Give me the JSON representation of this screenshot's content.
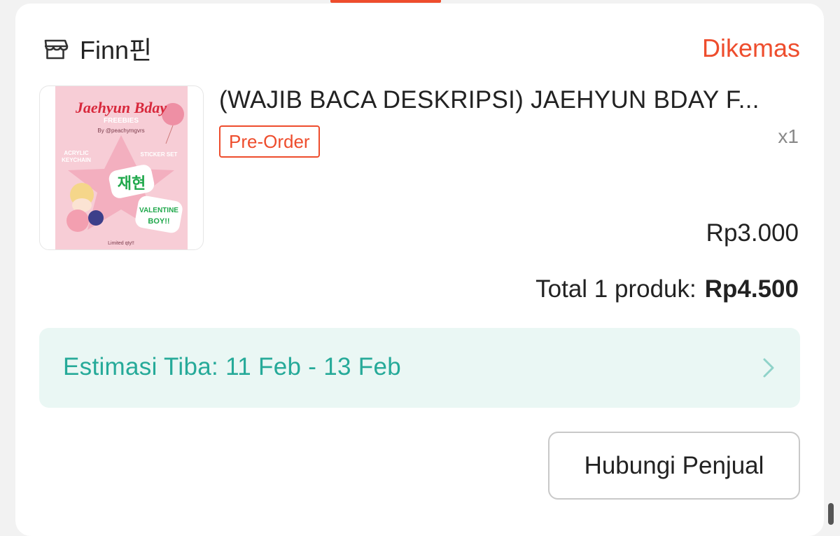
{
  "shop": {
    "name": "Finn핀",
    "icon": "store-icon"
  },
  "order": {
    "status": "Dikemas"
  },
  "product": {
    "title": "(WAJIB BACA DESKRIPSI) JAEHYUN BDAY F...",
    "badge": "Pre-Order",
    "quantity": "x1",
    "price": "Rp3.000",
    "image": {
      "title": "Jaehyun Bday",
      "subtitle": "FREEBIES",
      "by": "By @peachymgvrs",
      "left_label_1": "ACRYLIC",
      "left_label_2": "KEYCHAIN",
      "right_label": "STICKER SET",
      "sticker_korean": "재현",
      "sticker_line_1": "VALENTINE",
      "sticker_line_2": "BOY!!",
      "footer": "Limited qty!!"
    }
  },
  "total": {
    "label": "Total 1 produk:",
    "amount": "Rp4.500"
  },
  "eta": {
    "text": "Estimasi Tiba: 11 Feb - 13 Feb",
    "icon": "chevron-right-icon"
  },
  "actions": {
    "contact_seller": "Hubungi Penjual"
  },
  "colors": {
    "accent": "#ee4d2d",
    "eta_text": "#26aa99",
    "eta_bg": "#eaf7f4"
  }
}
